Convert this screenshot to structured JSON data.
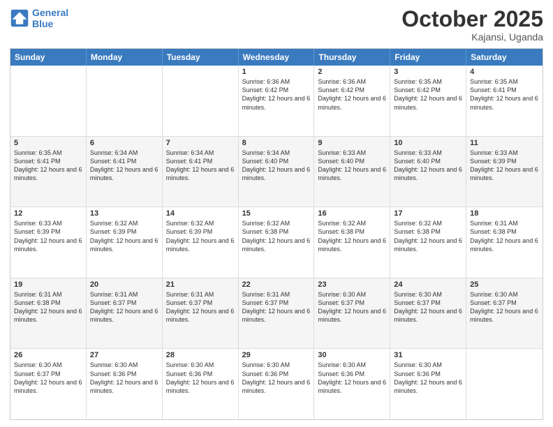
{
  "header": {
    "logo": {
      "line1": "General",
      "line2": "Blue"
    },
    "title": "October 2025",
    "location": "Kajansi, Uganda"
  },
  "calendar": {
    "days_of_week": [
      "Sunday",
      "Monday",
      "Tuesday",
      "Wednesday",
      "Thursday",
      "Friday",
      "Saturday"
    ],
    "weeks": [
      [
        {
          "day": "",
          "empty": true
        },
        {
          "day": "",
          "empty": true
        },
        {
          "day": "",
          "empty": true
        },
        {
          "day": "1",
          "sunrise": "Sunrise: 6:36 AM",
          "sunset": "Sunset: 6:42 PM",
          "daylight": "Daylight: 12 hours and 6 minutes."
        },
        {
          "day": "2",
          "sunrise": "Sunrise: 6:36 AM",
          "sunset": "Sunset: 6:42 PM",
          "daylight": "Daylight: 12 hours and 6 minutes."
        },
        {
          "day": "3",
          "sunrise": "Sunrise: 6:35 AM",
          "sunset": "Sunset: 6:42 PM",
          "daylight": "Daylight: 12 hours and 6 minutes."
        },
        {
          "day": "4",
          "sunrise": "Sunrise: 6:35 AM",
          "sunset": "Sunset: 6:41 PM",
          "daylight": "Daylight: 12 hours and 6 minutes."
        }
      ],
      [
        {
          "day": "5",
          "sunrise": "Sunrise: 6:35 AM",
          "sunset": "Sunset: 6:41 PM",
          "daylight": "Daylight: 12 hours and 6 minutes."
        },
        {
          "day": "6",
          "sunrise": "Sunrise: 6:34 AM",
          "sunset": "Sunset: 6:41 PM",
          "daylight": "Daylight: 12 hours and 6 minutes."
        },
        {
          "day": "7",
          "sunrise": "Sunrise: 6:34 AM",
          "sunset": "Sunset: 6:41 PM",
          "daylight": "Daylight: 12 hours and 6 minutes."
        },
        {
          "day": "8",
          "sunrise": "Sunrise: 6:34 AM",
          "sunset": "Sunset: 6:40 PM",
          "daylight": "Daylight: 12 hours and 6 minutes."
        },
        {
          "day": "9",
          "sunrise": "Sunrise: 6:33 AM",
          "sunset": "Sunset: 6:40 PM",
          "daylight": "Daylight: 12 hours and 6 minutes."
        },
        {
          "day": "10",
          "sunrise": "Sunrise: 6:33 AM",
          "sunset": "Sunset: 6:40 PM",
          "daylight": "Daylight: 12 hours and 6 minutes."
        },
        {
          "day": "11",
          "sunrise": "Sunrise: 6:33 AM",
          "sunset": "Sunset: 6:39 PM",
          "daylight": "Daylight: 12 hours and 6 minutes."
        }
      ],
      [
        {
          "day": "12",
          "sunrise": "Sunrise: 6:33 AM",
          "sunset": "Sunset: 6:39 PM",
          "daylight": "Daylight: 12 hours and 6 minutes."
        },
        {
          "day": "13",
          "sunrise": "Sunrise: 6:32 AM",
          "sunset": "Sunset: 6:39 PM",
          "daylight": "Daylight: 12 hours and 6 minutes."
        },
        {
          "day": "14",
          "sunrise": "Sunrise: 6:32 AM",
          "sunset": "Sunset: 6:39 PM",
          "daylight": "Daylight: 12 hours and 6 minutes."
        },
        {
          "day": "15",
          "sunrise": "Sunrise: 6:32 AM",
          "sunset": "Sunset: 6:38 PM",
          "daylight": "Daylight: 12 hours and 6 minutes."
        },
        {
          "day": "16",
          "sunrise": "Sunrise: 6:32 AM",
          "sunset": "Sunset: 6:38 PM",
          "daylight": "Daylight: 12 hours and 6 minutes."
        },
        {
          "day": "17",
          "sunrise": "Sunrise: 6:32 AM",
          "sunset": "Sunset: 6:38 PM",
          "daylight": "Daylight: 12 hours and 6 minutes."
        },
        {
          "day": "18",
          "sunrise": "Sunrise: 6:31 AM",
          "sunset": "Sunset: 6:38 PM",
          "daylight": "Daylight: 12 hours and 6 minutes."
        }
      ],
      [
        {
          "day": "19",
          "sunrise": "Sunrise: 6:31 AM",
          "sunset": "Sunset: 6:38 PM",
          "daylight": "Daylight: 12 hours and 6 minutes."
        },
        {
          "day": "20",
          "sunrise": "Sunrise: 6:31 AM",
          "sunset": "Sunset: 6:37 PM",
          "daylight": "Daylight: 12 hours and 6 minutes."
        },
        {
          "day": "21",
          "sunrise": "Sunrise: 6:31 AM",
          "sunset": "Sunset: 6:37 PM",
          "daylight": "Daylight: 12 hours and 6 minutes."
        },
        {
          "day": "22",
          "sunrise": "Sunrise: 6:31 AM",
          "sunset": "Sunset: 6:37 PM",
          "daylight": "Daylight: 12 hours and 6 minutes."
        },
        {
          "day": "23",
          "sunrise": "Sunrise: 6:30 AM",
          "sunset": "Sunset: 6:37 PM",
          "daylight": "Daylight: 12 hours and 6 minutes."
        },
        {
          "day": "24",
          "sunrise": "Sunrise: 6:30 AM",
          "sunset": "Sunset: 6:37 PM",
          "daylight": "Daylight: 12 hours and 6 minutes."
        },
        {
          "day": "25",
          "sunrise": "Sunrise: 6:30 AM",
          "sunset": "Sunset: 6:37 PM",
          "daylight": "Daylight: 12 hours and 6 minutes."
        }
      ],
      [
        {
          "day": "26",
          "sunrise": "Sunrise: 6:30 AM",
          "sunset": "Sunset: 6:37 PM",
          "daylight": "Daylight: 12 hours and 6 minutes."
        },
        {
          "day": "27",
          "sunrise": "Sunrise: 6:30 AM",
          "sunset": "Sunset: 6:36 PM",
          "daylight": "Daylight: 12 hours and 6 minutes."
        },
        {
          "day": "28",
          "sunrise": "Sunrise: 6:30 AM",
          "sunset": "Sunset: 6:36 PM",
          "daylight": "Daylight: 12 hours and 6 minutes."
        },
        {
          "day": "29",
          "sunrise": "Sunrise: 6:30 AM",
          "sunset": "Sunset: 6:36 PM",
          "daylight": "Daylight: 12 hours and 6 minutes."
        },
        {
          "day": "30",
          "sunrise": "Sunrise: 6:30 AM",
          "sunset": "Sunset: 6:36 PM",
          "daylight": "Daylight: 12 hours and 6 minutes."
        },
        {
          "day": "31",
          "sunrise": "Sunrise: 6:30 AM",
          "sunset": "Sunset: 6:36 PM",
          "daylight": "Daylight: 12 hours and 6 minutes."
        },
        {
          "day": "",
          "empty": true
        }
      ]
    ]
  }
}
